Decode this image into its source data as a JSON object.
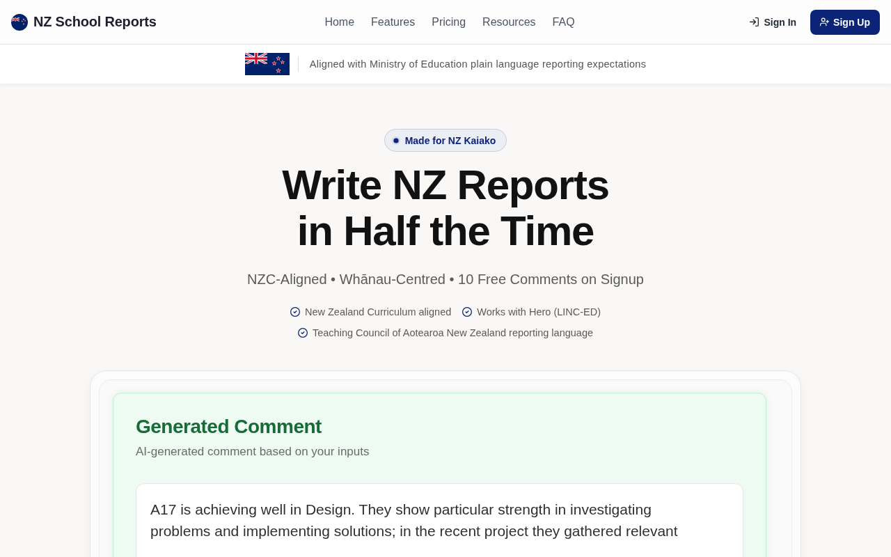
{
  "header": {
    "brand": "NZ School Reports",
    "nav": [
      {
        "label": "Home"
      },
      {
        "label": "Features"
      },
      {
        "label": "Pricing"
      },
      {
        "label": "Resources"
      },
      {
        "label": "FAQ"
      }
    ],
    "sign_in": "Sign In",
    "sign_up": "Sign Up"
  },
  "banner": {
    "text": "Aligned with Ministry of Education plain language reporting expectations"
  },
  "hero": {
    "badge": "Made for NZ Kaiako",
    "title_lines": [
      "Write NZ Reports",
      "in Half the Time"
    ],
    "subtitle": "NZC-Aligned • Whānau-Centred • 10 Free Comments on Signup",
    "features": [
      "New Zealand Curriculum aligned",
      "Works with Hero (LINC-ED)",
      "Teaching Council of Aotearoa New Zealand reporting language"
    ]
  },
  "preview": {
    "title": "Generated Comment",
    "subtitle": "AI-generated comment based on your inputs",
    "comment": "A17 is achieving well in Design. They show particular strength in investigating problems and implementing solutions; in the recent project they gathered relevant"
  }
}
